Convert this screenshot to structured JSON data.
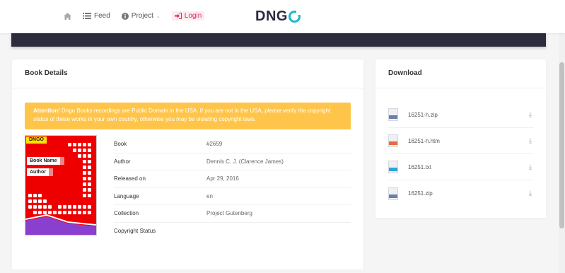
{
  "nav": {
    "feed_label": "Feed",
    "project_label": "Project",
    "login_label": "Login",
    "logo_text": "DNG"
  },
  "details": {
    "title": "Book Details",
    "alert_strong": "Attention!",
    "alert_text": " Dngo Books recordings are Public Domain in the USA. If you are not in the USA, please verify the copyright status of these works in your own country, otherwise you may be violating copyright laws.",
    "cover": {
      "badge": "DNGO",
      "book_label": "Book Name",
      "author_label": "Author"
    },
    "rows": [
      {
        "key": "Book",
        "value": "#2659"
      },
      {
        "key": "Author",
        "value": "Dennis C. J. (Clarence James)"
      },
      {
        "key": "Released on",
        "value": "Apr 29, 2016"
      },
      {
        "key": "Language",
        "value": "en"
      },
      {
        "key": "Collection",
        "value": "Project Gutenberg"
      },
      {
        "key": "Copyright Status",
        "value": ""
      }
    ]
  },
  "download": {
    "title": "Download",
    "files": [
      {
        "name": "16251-h.zip",
        "icon": "zip-file-icon",
        "color": "#6a7fa8"
      },
      {
        "name": "16251-h.htm",
        "icon": "html-file-icon",
        "color": "#e86a3a"
      },
      {
        "name": "16251.txt",
        "icon": "txt-file-icon",
        "color": "#2aa6d8"
      },
      {
        "name": "16251.zip",
        "icon": "zip-file-icon",
        "color": "#6a7fa8"
      }
    ]
  },
  "colors": {
    "accent": "#1bb9c9",
    "alert": "#fec54a",
    "login": "#e0245e",
    "banner": "#2d2c3c"
  }
}
